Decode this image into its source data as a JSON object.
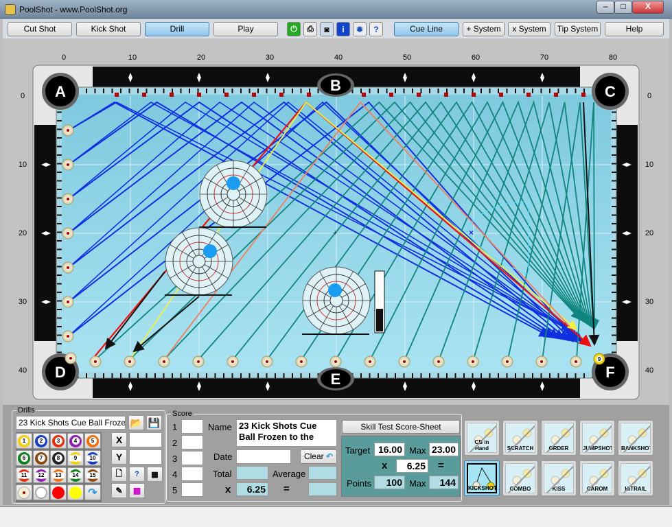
{
  "window": {
    "title": "PoolShot - www.PoolShot.org",
    "minimize": "–",
    "maximize": "□",
    "close": "X"
  },
  "toolbar": {
    "cut_shot": "Cut Shot",
    "kick_shot": "Kick Shot",
    "drill": "Drill",
    "play": "Play",
    "cue_line": "Cue Line",
    "plus_system": "+ System",
    "x_system": "x System",
    "tip_system": "Tip System",
    "help": "Help",
    "active_mode": "Drill"
  },
  "ruler": {
    "x": [
      "0",
      "10",
      "20",
      "30",
      "40",
      "50",
      "60",
      "70",
      "80"
    ],
    "y": [
      "0",
      "10",
      "20",
      "30",
      "40"
    ]
  },
  "pockets": {
    "a": "A",
    "b": "B",
    "c": "C",
    "d": "D",
    "e": "E",
    "f": "F"
  },
  "object_ball": "9",
  "drills": {
    "legend": "Drills",
    "drill_name": "23 Kick Shots Cue Ball Frozen to",
    "balls": [
      "1",
      "2",
      "3",
      "4",
      "5",
      "6",
      "7",
      "8",
      "9",
      "10",
      "11",
      "12",
      "13",
      "14",
      "15"
    ],
    "x_label": "X",
    "y_label": "Y",
    "x_value": "",
    "y_value": ""
  },
  "score": {
    "legend": "Score",
    "rows": [
      "1",
      "2",
      "3",
      "4",
      "5"
    ],
    "name_label": "Name",
    "name_value": "23 Kick Shots Cue Ball Frozen to the",
    "date_label": "Date",
    "date_value": "",
    "clear": "Clear",
    "total_label": "Total",
    "total_value": "",
    "average_label": "Average",
    "average_value": "",
    "x_label": "x",
    "x_value": "6.25",
    "eq": "=",
    "result_value": ""
  },
  "skill": {
    "button": "Skill Test Score-Sheet",
    "target_label": "Target",
    "target": "16.00",
    "max_label": "Max",
    "max": "23.00",
    "x_label": "x",
    "multiplier": "6.25",
    "eq": "=",
    "points_label": "Points",
    "points": "100",
    "points_max_label": "Max",
    "points_max": "144"
  },
  "shot_types": [
    "CB in Hand",
    "SCRATCH",
    "ORDER",
    "JUMPSHOT",
    "BANKSHOT",
    "KICKSHOT",
    "COMBO",
    "KISS",
    "CAROM",
    "HITRAIL"
  ],
  "selected_shot_type": "KICKSHOT",
  "colors": {
    "cloth": "#8fd4e6",
    "blue_path": "#1030e0",
    "teal_path": "#10857f",
    "red_path": "#ee1010",
    "yellow_path": "#f0f040",
    "orange_path": "#f08060"
  }
}
